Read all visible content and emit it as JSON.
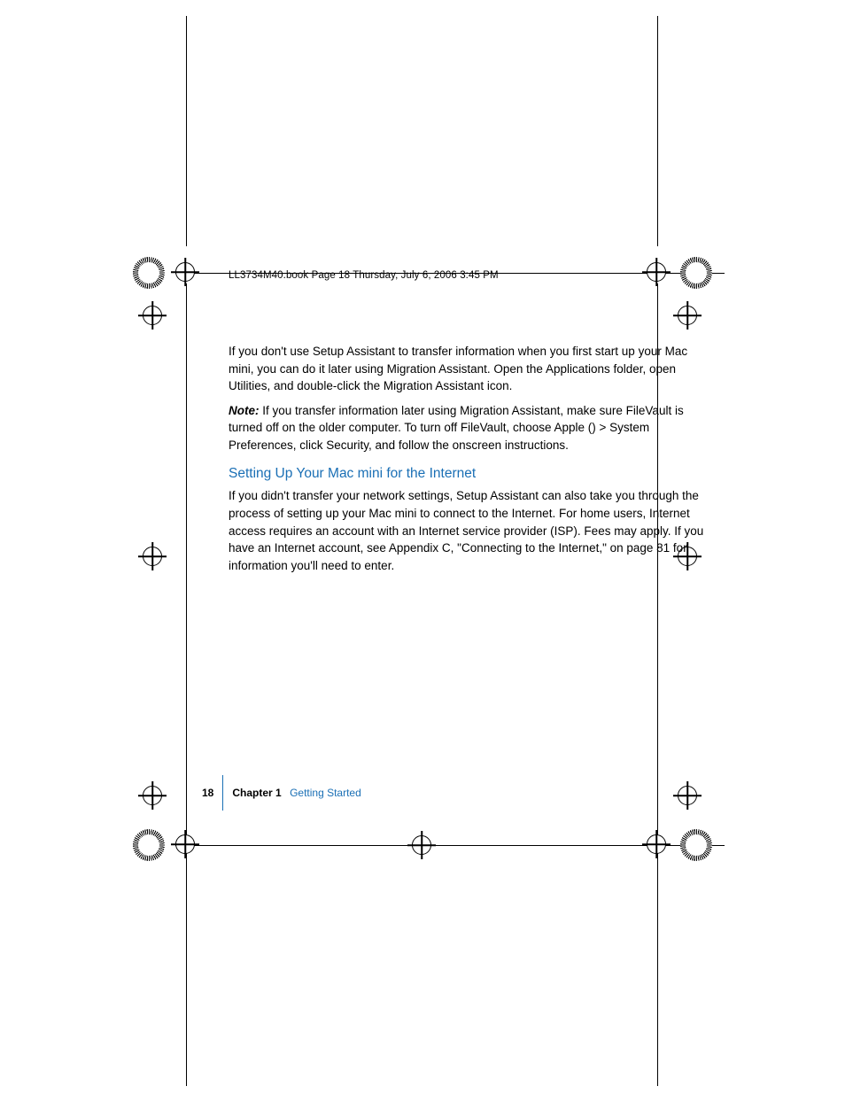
{
  "header": "LL3734M40.book  Page 18  Thursday, July 6, 2006  3:45 PM",
  "para1": "If you don't use Setup Assistant to transfer information when you first start up your Mac mini, you can do it later using Migration Assistant. Open the Applications folder, open Utilities, and double-click the Migration Assistant icon.",
  "note_label": "Note:  ",
  "note_body_a": "If you transfer information later using Migration Assistant, make sure FileVault is turned off on the older computer. To turn off FileVault, choose Apple (",
  "note_body_b": ") > System Preferences, click Security, and follow the onscreen instructions.",
  "heading": "Setting Up Your Mac mini for the Internet",
  "para2": "If you didn't transfer your network settings, Setup Assistant can also take you through the process of setting up your Mac mini to connect to the Internet. For home users, Internet access requires an account with an Internet service provider (ISP). Fees may apply. If you have an Internet account, see Appendix C, \"Connecting to the Internet,\" on page 81 for information you'll need to enter.",
  "footer": {
    "page": "18",
    "chapter": "Chapter 1",
    "title": "Getting Started"
  }
}
